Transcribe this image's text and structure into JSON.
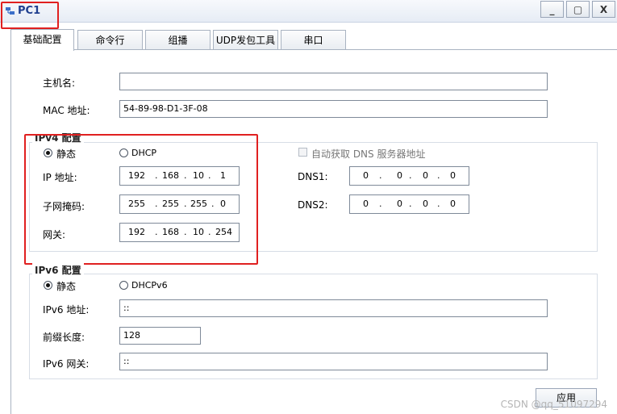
{
  "window": {
    "title": "PC1",
    "minimize_label": "_",
    "maximize_label": "▢",
    "close_label": "X"
  },
  "tabs": [
    "基础配置",
    "命令行",
    "组播",
    "UDP发包工具",
    "串口"
  ],
  "form": {
    "hostname_label": "主机名:",
    "hostname_value": "",
    "mac_label": "MAC 地址:",
    "mac_value": "54-89-98-D1-3F-08"
  },
  "ipv4": {
    "legend": "IPv4 配置",
    "static_label": "静态",
    "dhcp_label": "DHCP",
    "mode": "static",
    "auto_dns_label": "自动获取 DNS 服务器地址",
    "ip_label": "IP 地址:",
    "ip": [
      "192",
      "168",
      "10",
      "1"
    ],
    "mask_label": "子网掩码:",
    "mask": [
      "255",
      "255",
      "255",
      "0"
    ],
    "gateway_label": "网关:",
    "gateway": [
      "192",
      "168",
      "10",
      "254"
    ],
    "dns1_label": "DNS1:",
    "dns1": [
      "0",
      "0",
      "0",
      "0"
    ],
    "dns2_label": "DNS2:",
    "dns2": [
      "0",
      "0",
      "0",
      "0"
    ]
  },
  "ipv6": {
    "legend": "IPv6 配置",
    "static_label": "静态",
    "dhcp_label": "DHCPv6",
    "mode": "static",
    "addr_label": "IPv6 地址:",
    "addr_value": "::",
    "prefix_label": "前缀长度:",
    "prefix_value": "128",
    "gateway_label": "IPv6 网关:",
    "gateway_value": "::"
  },
  "apply_label": "应用",
  "watermark": "CSDN @qq_51097294",
  "colors": {
    "annotation": "#e02020",
    "title": "#1f3f8f"
  }
}
